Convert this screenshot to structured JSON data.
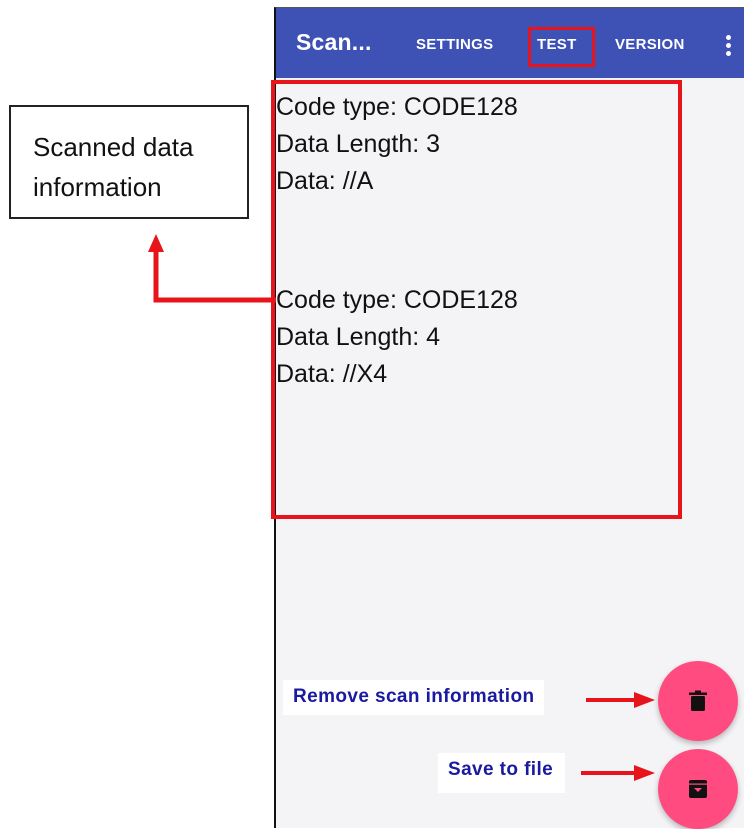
{
  "toolbar": {
    "title": "Scan...",
    "tabs": {
      "settings": "SETTINGS",
      "test": "TEST",
      "version": "VERSION"
    },
    "color": "#3e51b5"
  },
  "scan_results": [
    {
      "code_type": "Code type: CODE128",
      "length": "Data Length: 3",
      "data": "Data: //A"
    },
    {
      "code_type": "Code type: CODE128",
      "length": "Data Length: 4",
      "data": "Data: //X4"
    }
  ],
  "callout": {
    "line1": "Scanned data",
    "line2": "information"
  },
  "actions": {
    "remove_label": "Remove scan information",
    "save_label": "Save to file",
    "fab_color": "#ff4b80",
    "remove_icon": "trash-icon",
    "save_icon": "archive-icon"
  },
  "annotation_color": "#e8141b"
}
